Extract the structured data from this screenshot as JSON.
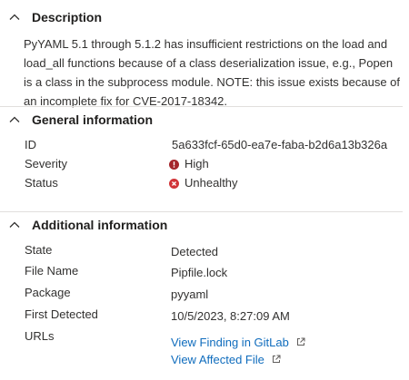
{
  "description": {
    "title": "Description",
    "text": "PyYAML 5.1 through 5.1.2 has insufficient restrictions on the load and load_all functions because of a class deserialization issue, e.g., Popen is a class in the subprocess module. NOTE: this issue exists because of an incomplete fix for CVE-2017-18342."
  },
  "general": {
    "title": "General information",
    "rows": [
      {
        "key": "ID",
        "value": "5a633fcf-65d0-ea7e-faba-b2d6a13b326a"
      },
      {
        "key": "Severity",
        "value": "High",
        "icon": "severity-high-icon",
        "color": "#a4262c"
      },
      {
        "key": "Status",
        "value": "Unhealthy",
        "icon": "error-circle-icon",
        "color": "#d13438"
      }
    ]
  },
  "additional": {
    "title": "Additional information",
    "rows": [
      {
        "key": "State",
        "value": "Detected"
      },
      {
        "key": "File Name",
        "value": "Pipfile.lock"
      },
      {
        "key": "Package",
        "value": "pyyaml"
      },
      {
        "key": "First Detected",
        "value": "10/5/2023, 8:27:09 AM"
      },
      {
        "key": "URLs",
        "links": [
          "View Finding in GitLab",
          "View Affected File"
        ]
      }
    ]
  },
  "icons": {
    "section_toggle": "chevron-up-icon",
    "external_link": "open-external-icon"
  },
  "colors": {
    "link": "#0f6cbd",
    "severity_high": "#a4262c",
    "unhealthy": "#d13438"
  }
}
